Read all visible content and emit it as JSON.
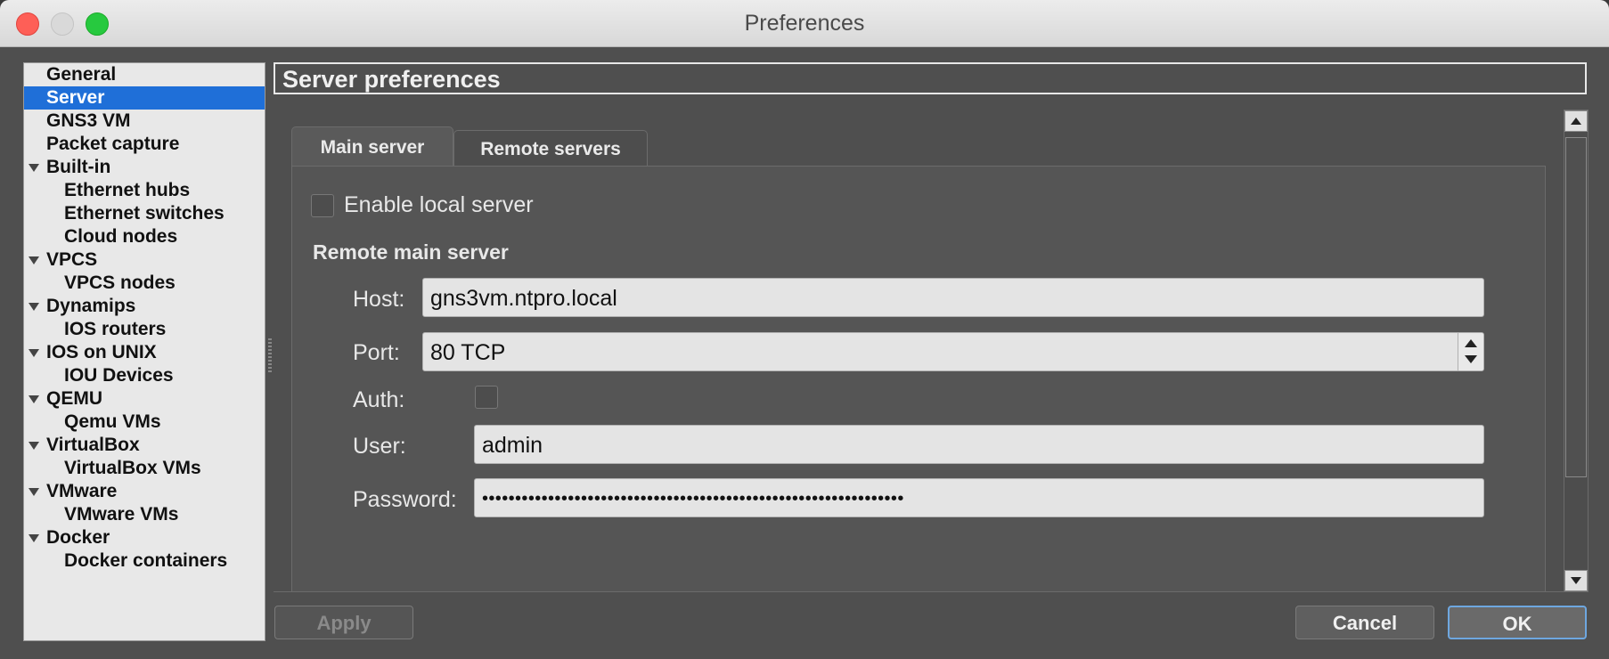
{
  "window": {
    "title": "Preferences"
  },
  "sidebar": {
    "items": [
      {
        "label": "General",
        "level": 0,
        "expandable": false,
        "selected": false
      },
      {
        "label": "Server",
        "level": 0,
        "expandable": false,
        "selected": true
      },
      {
        "label": "GNS3 VM",
        "level": 0,
        "expandable": false,
        "selected": false
      },
      {
        "label": "Packet capture",
        "level": 0,
        "expandable": false,
        "selected": false
      },
      {
        "label": "Built-in",
        "level": 0,
        "expandable": true,
        "selected": false
      },
      {
        "label": "Ethernet hubs",
        "level": 1,
        "expandable": false,
        "selected": false
      },
      {
        "label": "Ethernet switches",
        "level": 1,
        "expandable": false,
        "selected": false
      },
      {
        "label": "Cloud nodes",
        "level": 1,
        "expandable": false,
        "selected": false
      },
      {
        "label": "VPCS",
        "level": 0,
        "expandable": true,
        "selected": false
      },
      {
        "label": "VPCS nodes",
        "level": 1,
        "expandable": false,
        "selected": false
      },
      {
        "label": "Dynamips",
        "level": 0,
        "expandable": true,
        "selected": false
      },
      {
        "label": "IOS routers",
        "level": 1,
        "expandable": false,
        "selected": false
      },
      {
        "label": "IOS on UNIX",
        "level": 0,
        "expandable": true,
        "selected": false
      },
      {
        "label": "IOU Devices",
        "level": 1,
        "expandable": false,
        "selected": false
      },
      {
        "label": "QEMU",
        "level": 0,
        "expandable": true,
        "selected": false
      },
      {
        "label": "Qemu VMs",
        "level": 1,
        "expandable": false,
        "selected": false
      },
      {
        "label": "VirtualBox",
        "level": 0,
        "expandable": true,
        "selected": false
      },
      {
        "label": "VirtualBox VMs",
        "level": 1,
        "expandable": false,
        "selected": false
      },
      {
        "label": "VMware",
        "level": 0,
        "expandable": true,
        "selected": false
      },
      {
        "label": "VMware VMs",
        "level": 1,
        "expandable": false,
        "selected": false
      },
      {
        "label": "Docker",
        "level": 0,
        "expandable": true,
        "selected": false
      },
      {
        "label": "Docker containers",
        "level": 1,
        "expandable": false,
        "selected": false
      }
    ]
  },
  "header": {
    "title": "Server preferences"
  },
  "tabs": [
    {
      "label": "Main server",
      "active": true
    },
    {
      "label": "Remote servers",
      "active": false
    }
  ],
  "main_server": {
    "enable_local_label": "Enable local server",
    "enable_local_checked": false,
    "remote_section_label": "Remote main server",
    "host_label": "Host:",
    "host_value": "gns3vm.ntpro.local",
    "port_label": "Port:",
    "port_value": "80 TCP",
    "auth_label": "Auth:",
    "auth_checked": false,
    "user_label": "User:",
    "user_value": "admin",
    "password_label": "Password:",
    "password_value": "••••••••••••••••••••••••••••••••••••••••••••••••••••••••••••••••"
  },
  "buttons": {
    "apply": "Apply",
    "cancel": "Cancel",
    "ok": "OK"
  },
  "colors": {
    "selection": "#1f6fd8",
    "window_bg": "#4f4f4f",
    "close": "#fe5f57",
    "maximize": "#27c93f"
  }
}
